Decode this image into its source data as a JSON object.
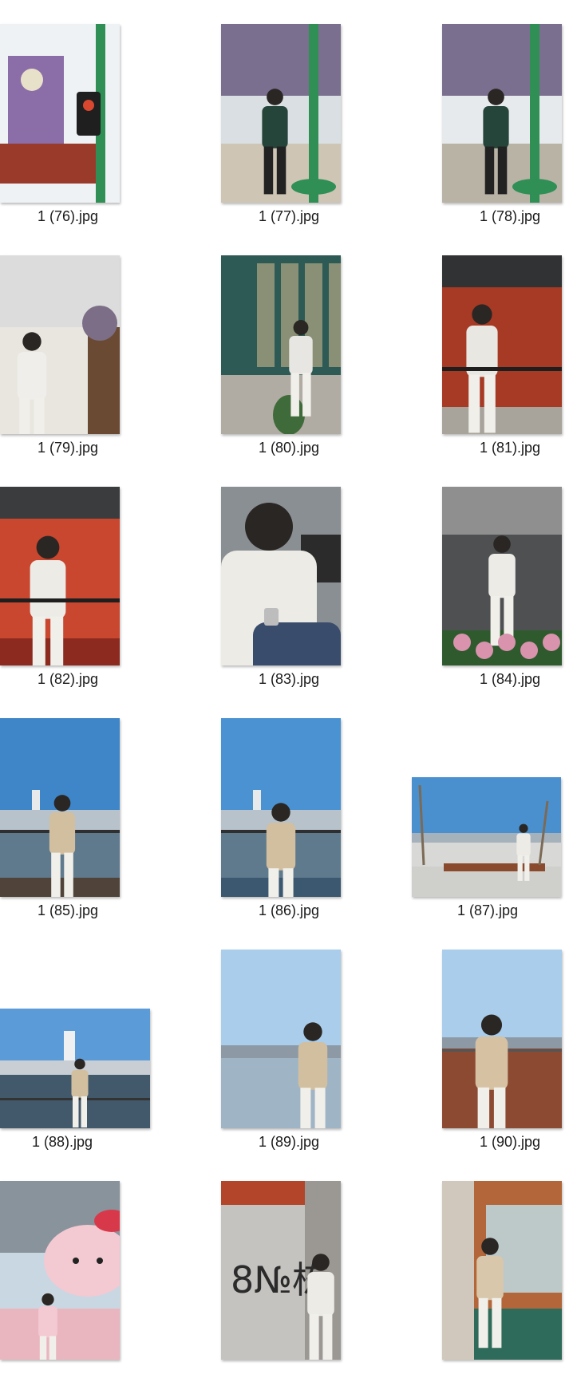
{
  "files": [
    {
      "name": "1 (76).jpg",
      "orientation": "portrait",
      "scene": "theme-park-signs",
      "colors": {
        "sky": "#eef2f4",
        "ground": "#9a3a2a",
        "accent": "#2f8f55",
        "subject": "#d6c6a8"
      }
    },
    {
      "name": "1 (77).jpg",
      "orientation": "portrait",
      "scene": "theme-park-street",
      "colors": {
        "sky": "#d9dfe2",
        "ground": "#cfc5b5",
        "accent": "#2f8f55",
        "subject": "#25443a"
      }
    },
    {
      "name": "1 (78).jpg",
      "orientation": "portrait",
      "scene": "theme-park-street",
      "colors": {
        "sky": "#e7eaec",
        "ground": "#b9b3a6",
        "accent": "#2f8f55",
        "subject": "#25443a"
      }
    },
    {
      "name": "1 (79).jpg",
      "orientation": "portrait",
      "scene": "indoor-flowers",
      "colors": {
        "sky": "#dcdcdc",
        "ground": "#e9e6e0",
        "accent": "#6b4a34",
        "subject": "#efeeea"
      }
    },
    {
      "name": "1 (80).jpg",
      "orientation": "portrait",
      "scene": "cafe-window-chair",
      "colors": {
        "sky": "#2e5a55",
        "ground": "#b0aca4",
        "accent": "#3f6b3a",
        "subject": "#e8e6e2"
      }
    },
    {
      "name": "1 (81).jpg",
      "orientation": "portrait",
      "scene": "red-cafe-railing",
      "colors": {
        "sky": "#303234",
        "ground": "#a8a49c",
        "accent": "#a63a25",
        "subject": "#e9e7e2"
      }
    },
    {
      "name": "1 (82).jpg",
      "orientation": "portrait",
      "scene": "red-cafe-railing-close",
      "colors": {
        "sky": "#3a3c3e",
        "ground": "#8c2a1f",
        "accent": "#c9462f",
        "subject": "#ecebe6"
      }
    },
    {
      "name": "1 (83).jpg",
      "orientation": "portrait",
      "scene": "close-portrait-watch",
      "colors": {
        "sky": "#8a8f93",
        "ground": "#394c6b",
        "accent": "#2b2b2b",
        "subject": "#ecebe6"
      }
    },
    {
      "name": "1 (84).jpg",
      "orientation": "portrait",
      "scene": "flowers-street",
      "colors": {
        "sky": "#6c6e70",
        "ground": "#2f5a2e",
        "accent": "#d993ad",
        "subject": "#ecebe6"
      }
    },
    {
      "name": "1 (85).jpg",
      "orientation": "portrait",
      "scene": "riverfront-standing",
      "colors": {
        "sky": "#3f86c9",
        "ground": "#50433a",
        "accent": "#5f7a8d",
        "subject": "#d2bfa0"
      }
    },
    {
      "name": "1 (86).jpg",
      "orientation": "portrait",
      "scene": "riverfront-railing",
      "colors": {
        "sky": "#4b92d3",
        "ground": "#3b5870",
        "accent": "#5f7a8d",
        "subject": "#d2bfa0"
      }
    },
    {
      "name": "1 (87).jpg",
      "orientation": "landscape",
      "scene": "riverfront-bench",
      "colors": {
        "sky": "#4a90cf",
        "ground": "#d8d8d6",
        "accent": "#8a4a2e",
        "subject": "#ecebe6"
      }
    },
    {
      "name": "1 (88).jpg",
      "orientation": "landscape",
      "scene": "riverfront-skyline",
      "colors": {
        "sky": "#5a9bd8",
        "ground": "#42596c",
        "accent": "#c8ced4",
        "subject": "#d2bfa0"
      }
    },
    {
      "name": "1 (89).jpg",
      "orientation": "portrait",
      "scene": "plaza-walking",
      "colors": {
        "sky": "#a9cdea",
        "ground": "#9fb4c5",
        "accent": "#6f7d88",
        "subject": "#d2bfa0"
      }
    },
    {
      "name": "1 (90).jpg",
      "orientation": "portrait",
      "scene": "boardwalk-back",
      "colors": {
        "sky": "#a9cdea",
        "ground": "#8c4a33",
        "accent": "#6f7d88",
        "subject": "#d6c2a3"
      }
    },
    {
      "name": "",
      "orientation": "portrait",
      "scene": "hello-kitty",
      "colors": {
        "sky": "#c9d7e2",
        "ground": "#e9b6bf",
        "accent": "#e48a9c",
        "subject": "#f3c9d2"
      }
    },
    {
      "name": "",
      "orientation": "portrait",
      "scene": "wall-building-8",
      "colors": {
        "sky": "#c4c3c0",
        "ground": "#9b9894",
        "accent": "#2b2b2b",
        "subject": "#ecebe6"
      }
    },
    {
      "name": "",
      "orientation": "portrait",
      "scene": "cafe-storefront",
      "colors": {
        "sky": "#dcd4c8",
        "ground": "#2f6b5a",
        "accent": "#b3663a",
        "subject": "#d8c7ab"
      }
    }
  ],
  "wall_text": "8№栋"
}
